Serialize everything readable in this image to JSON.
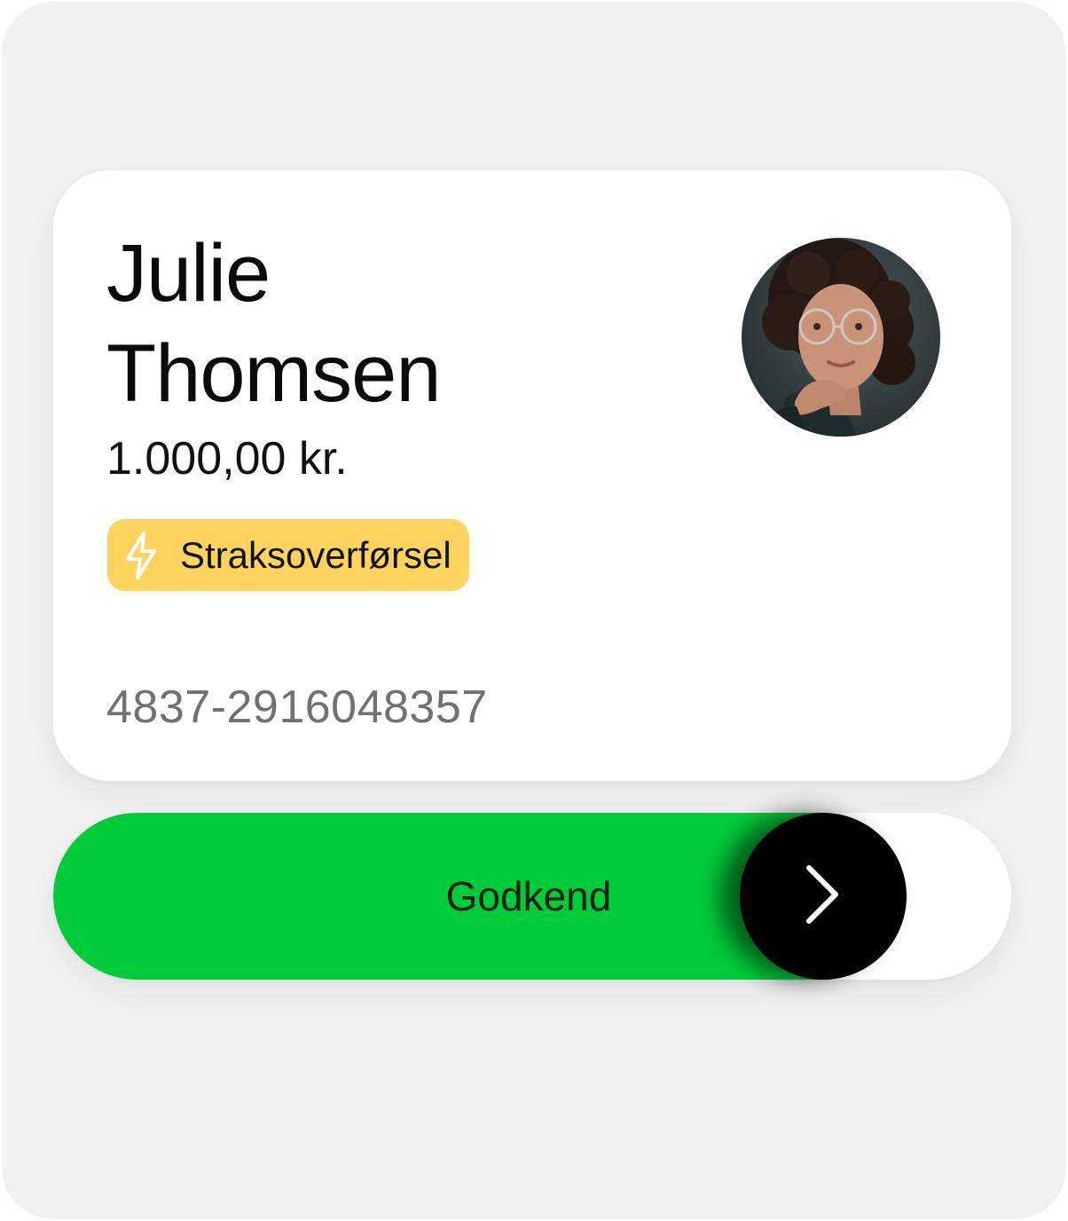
{
  "recipient": {
    "first_name": "Julie",
    "last_name": "Thomsen",
    "amount": "1.000,00 kr.",
    "badge_label": "Straksoverførsel",
    "account": "4837-2916048357",
    "avatar_icon": "person-avatar"
  },
  "slider": {
    "label": "Godkend",
    "progress": 0.8,
    "knob_icon": "chevron-right-icon"
  },
  "colors": {
    "background": "#f1f1f1",
    "card": "#ffffff",
    "badge": "#ffd45e",
    "slider_fill": "#00cc3a",
    "knob": "#000000",
    "account_text": "#717171"
  }
}
